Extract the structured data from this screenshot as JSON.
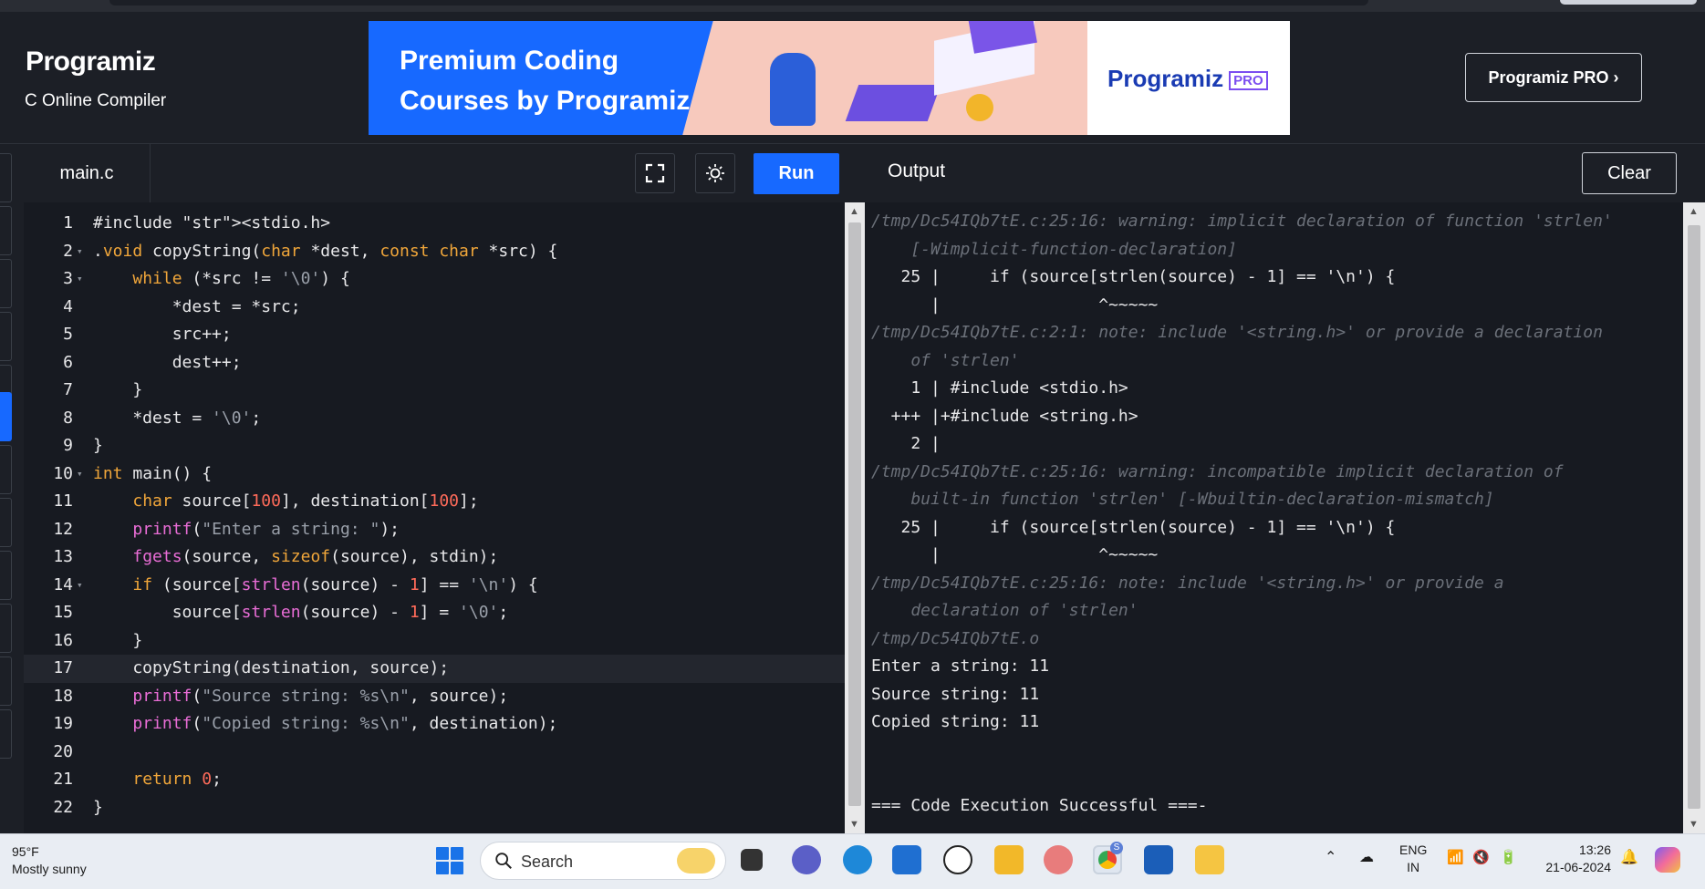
{
  "header": {
    "logo": "Programiz",
    "subtitle": "C Online Compiler",
    "banner_text": "Premium Coding Courses by Programiz",
    "banner_brand": "Programiz",
    "banner_badge": "PRO",
    "pro_button": "Programiz PRO ›"
  },
  "editor": {
    "tab": "main.c",
    "run_label": "Run"
  },
  "code": [
    "#include <stdio.h>",
    ".void copyString(char *dest, const char *src) {",
    "    while (*src != '\\0') {",
    "        *dest = *src;",
    "        src++;",
    "        dest++;",
    "    }",
    "    *dest = '\\0';",
    "}",
    "int main() {",
    "    char source[100], destination[100];",
    "    printf(\"Enter a string: \");",
    "    fgets(source, sizeof(source), stdin);",
    "    if (source[strlen(source) - 1] == '\\n') {",
    "        source[strlen(source) - 1] = '\\0';",
    "    }",
    "    copyString(destination, source);",
    "    printf(\"Source string: %s\\n\", source);",
    "    printf(\"Copied string: %s\\n\", destination);",
    "",
    "    return 0;",
    "}"
  ],
  "output": {
    "title": "Output",
    "clear_label": "Clear",
    "lines": [
      {
        "text": "/tmp/Dc54IQb7tE.c:25:16: warning: implicit declaration of function 'strlen'",
        "dim": true
      },
      {
        "text": "    [-Wimplicit-function-declaration]",
        "dim": true
      },
      {
        "text": "   25 |     if (source[strlen(source) - 1] == '\\n') {",
        "dim": false
      },
      {
        "text": "      |                ^~~~~~",
        "dim": false
      },
      {
        "text": "/tmp/Dc54IQb7tE.c:2:1: note: include '<string.h>' or provide a declaration",
        "dim": true
      },
      {
        "text": "    of 'strlen'",
        "dim": true
      },
      {
        "text": "    1 | #include <stdio.h>",
        "dim": false
      },
      {
        "text": "  +++ |+#include <string.h>",
        "dim": false
      },
      {
        "text": "    2 |",
        "dim": false
      },
      {
        "text": "/tmp/Dc54IQb7tE.c:25:16: warning: incompatible implicit declaration of",
        "dim": true
      },
      {
        "text": "    built-in function 'strlen' [-Wbuiltin-declaration-mismatch]",
        "dim": true
      },
      {
        "text": "   25 |     if (source[strlen(source) - 1] == '\\n') {",
        "dim": false
      },
      {
        "text": "      |                ^~~~~~",
        "dim": false
      },
      {
        "text": "/tmp/Dc54IQb7tE.c:25:16: note: include '<string.h>' or provide a",
        "dim": true
      },
      {
        "text": "    declaration of 'strlen'",
        "dim": true
      },
      {
        "text": "/tmp/Dc54IQb7tE.o",
        "dim": true
      },
      {
        "text": "Enter a string: 11",
        "dim": false
      },
      {
        "text": "Source string: 11",
        "dim": false
      },
      {
        "text": "Copied string: 11",
        "dim": false
      },
      {
        "text": "",
        "dim": false
      },
      {
        "text": "",
        "dim": false
      },
      {
        "text": "=== Code Execution Successful ===-",
        "dim": false
      }
    ]
  },
  "taskbar": {
    "weather_temp": "95°F",
    "weather_desc": "Mostly sunny",
    "search_placeholder": "Search",
    "lang_top": "ENG",
    "lang_bottom": "IN",
    "time": "13:26",
    "date": "21-06-2024",
    "chrome_badge": "S"
  },
  "colors": {
    "accent": "#1769ff",
    "background": "#1c1f26",
    "editor_bg": "#171a21",
    "keyword": "#f0a63a",
    "function": "#e96dd6",
    "number": "#ff6b5a"
  }
}
